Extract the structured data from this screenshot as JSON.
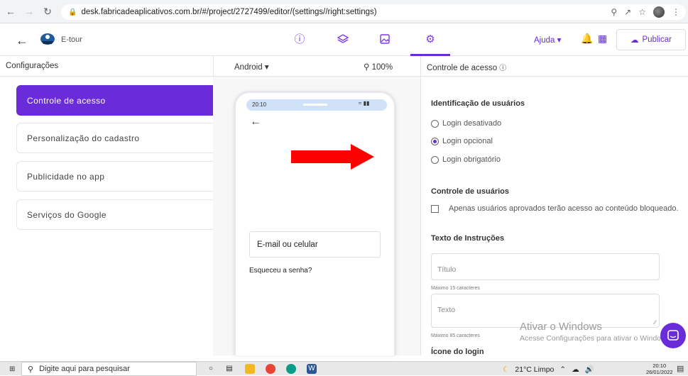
{
  "browser": {
    "url": "desk.fabricadeaplicativos.com.br/#/project/2727499/editor/(settings//right:settings)"
  },
  "app_bar": {
    "app_name": "E-tour",
    "help_label": "Ajuda",
    "publish_label": "Publicar"
  },
  "sub_bar": {
    "left_title": "Configurações",
    "platform": "Android",
    "zoom": "100%",
    "right_title": "Controle de acesso"
  },
  "menu": {
    "items": [
      {
        "label": "Controle de acesso"
      },
      {
        "label": "Personalização do cadastro"
      },
      {
        "label": "Publicidade no app"
      },
      {
        "label": "Serviços do Google"
      }
    ]
  },
  "phone": {
    "time": "20:10",
    "input_label": "E-mail ou celular",
    "forgot_label": "Esqueceu a senha?"
  },
  "settings": {
    "identification_title": "Identificação de usuários",
    "options": [
      {
        "label": "Login desativado",
        "selected": false
      },
      {
        "label": "Login opcional",
        "selected": true
      },
      {
        "label": "Login obrigatório",
        "selected": false
      }
    ],
    "user_control_title": "Controle de usuários",
    "user_control_checkbox": "Apenas usuários aprovados terão acesso ao conteúdo bloqueado.",
    "instructions_title": "Texto de Instruções",
    "title_placeholder": "Título",
    "title_hint": "Máximo 15 caracteres",
    "text_placeholder": "Texto",
    "text_hint": "Máximo 85 caracteres",
    "login_icon_title": "Ícone do login"
  },
  "watermark": {
    "line1": "Ativar o Windows",
    "line2": "Acesse Configurações para ativar o Windows."
  },
  "taskbar": {
    "search_placeholder": "Digite aqui para pesquisar",
    "weather": "21°C Limpo",
    "time": "20:10",
    "date": "26/01/2022"
  },
  "colors": {
    "accent": "#6a2bd9",
    "arrow": "#ff0000"
  }
}
